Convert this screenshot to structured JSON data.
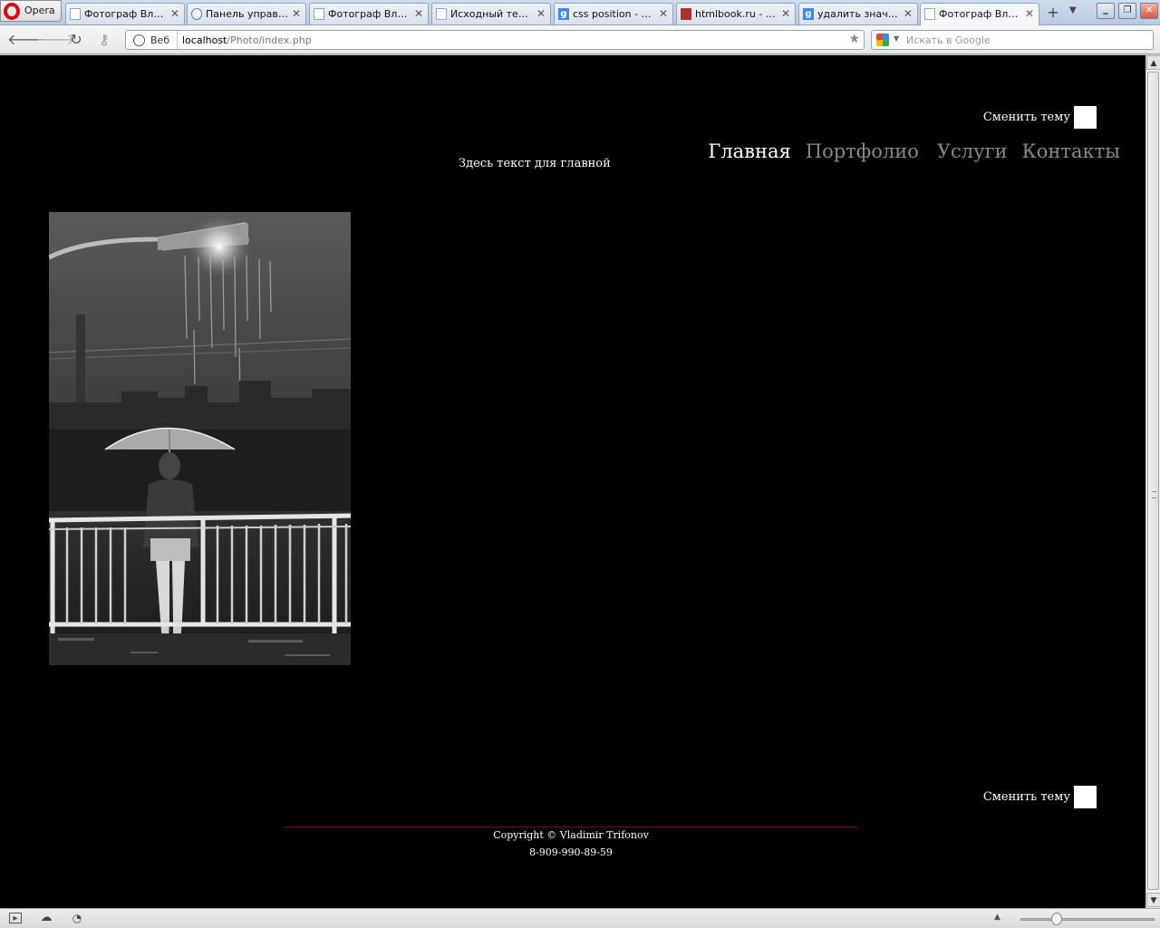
{
  "browser": {
    "menu_label": "Opera",
    "tabs": [
      {
        "title": "Фотограф Влад...",
        "icon": "page-icon"
      },
      {
        "title": "Панель управл...",
        "icon": "ra-icon"
      },
      {
        "title": "Фотограф Влад...",
        "icon": "page-icon"
      },
      {
        "title": "Исходный текс...",
        "icon": "page-icon"
      },
      {
        "title": "css position - По...",
        "icon": "google-icon"
      },
      {
        "title": "htmlbook.ru - CS...",
        "icon": "htmlbook-icon"
      },
      {
        "title": "удалить значе...",
        "icon": "google-icon"
      },
      {
        "title": "Фотограф Влад...",
        "icon": "page-icon",
        "active": true
      }
    ],
    "address": {
      "web_label": "Веб",
      "host": "localhost",
      "path": "/Photo/index.php"
    },
    "search_placeholder": "Искать в Google"
  },
  "page": {
    "theme_switch_label": "Сменить тему",
    "nav": [
      {
        "label": "Главная",
        "current": true
      },
      {
        "label": "Портфолио",
        "current": false
      },
      {
        "label": "Услуги",
        "current": false
      },
      {
        "label": "Контакты",
        "current": false
      }
    ],
    "intro_text": "Здесь текст для главной",
    "footer": {
      "copyright": "Copyright © Vladimir Trifonov",
      "phone": "8-909-990-89-59"
    }
  },
  "colors": {
    "page_background": "#000000",
    "nav_active": "#ffffff",
    "nav_inactive": "#888888",
    "footer_rule": "#7a1010",
    "opera_brand": "#d0101b"
  }
}
